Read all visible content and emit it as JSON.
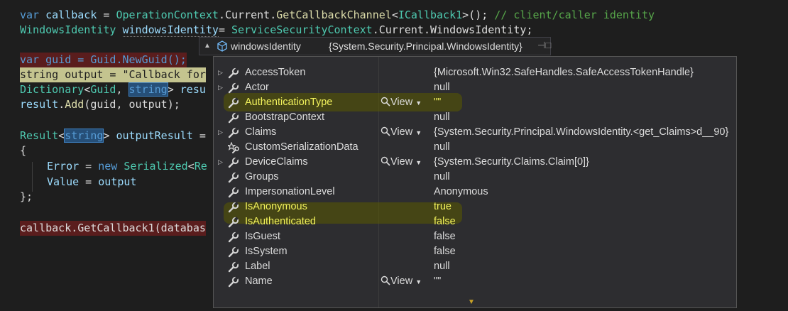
{
  "code": {
    "line1": {
      "kw": "var",
      "id": "callback",
      "eq": " = ",
      "t1": "OperationContext",
      "d1": ".",
      "p1": "Current",
      "d2": ".",
      "fn": "GetCallbackChannel",
      "lt": "<",
      "t2": "ICallback1",
      "rest": ">();",
      "comment": " // client/caller identity"
    },
    "line2": {
      "t1": "WindowsIdentity",
      "id": "windowsIdentity",
      "eq": "= ",
      "t2": "ServiceSecurityContext",
      "d1": ".",
      "p1": "Current",
      "d2": ".",
      "p2": "WindowsIdentity",
      "semi": ";"
    },
    "line4": {
      "text": "var guid = Guid.NewGuid();"
    },
    "line5": {
      "text": "string output = \"Callback for"
    },
    "line6": {
      "t1": "Dictionary",
      "lt": "<",
      "t2": "Guid",
      "comma": ", ",
      "kw": "string",
      "gt": "> ",
      "id": "resu"
    },
    "line7": {
      "id": "result",
      "d": ".",
      "fn": "Add",
      "args": "(guid, output);"
    },
    "line9": {
      "t1": "Result",
      "lt": "<",
      "kw": "string",
      "gt": "> ",
      "id": "outputResult",
      "eq": " ="
    },
    "line10": {
      "text": "{"
    },
    "line11": {
      "p": "Error",
      "eq": " = ",
      "kw": "new",
      "sp": " ",
      "t": "Serialized",
      "lt": "<",
      "t2": "Re"
    },
    "line12": {
      "p": "Value",
      "eq": " = ",
      "id": "output"
    },
    "line13": {
      "text": "};"
    },
    "line15": {
      "text": "callback.GetCallback1(databas"
    }
  },
  "datatip": {
    "name": "windowsIdentity",
    "value": "{System.Security.Principal.WindowsIdentity}",
    "view_label": "View",
    "rows": [
      {
        "name": "AccessToken",
        "expandable": true,
        "view": false,
        "value": "{Microsoft.Win32.SafeHandles.SafeAccessTokenHandle}",
        "icon": "wrench-icon",
        "highlight": false
      },
      {
        "name": "Actor",
        "expandable": true,
        "view": false,
        "value": "null",
        "icon": "wrench-icon",
        "highlight": false
      },
      {
        "name": "AuthenticationType",
        "expandable": false,
        "view": true,
        "value": "\"\"",
        "icon": "wrench-icon",
        "highlight": true
      },
      {
        "name": "BootstrapContext",
        "expandable": false,
        "view": false,
        "value": "null",
        "icon": "wrench-icon",
        "highlight": false
      },
      {
        "name": "Claims",
        "expandable": true,
        "view": true,
        "value": "{System.Security.Principal.WindowsIdentity.<get_Claims>d__90}",
        "icon": "wrench-icon",
        "highlight": false
      },
      {
        "name": "CustomSerializationData",
        "expandable": false,
        "view": false,
        "value": "null",
        "icon": "star-wrench-icon",
        "highlight": false
      },
      {
        "name": "DeviceClaims",
        "expandable": true,
        "view": true,
        "value": "{System.Security.Claims.Claim[0]}",
        "icon": "wrench-icon",
        "highlight": false
      },
      {
        "name": "Groups",
        "expandable": false,
        "view": false,
        "value": "null",
        "icon": "wrench-icon",
        "highlight": false
      },
      {
        "name": "ImpersonationLevel",
        "expandable": false,
        "view": false,
        "value": "Anonymous",
        "icon": "wrench-icon",
        "highlight": false
      },
      {
        "name": "IsAnonymous",
        "expandable": false,
        "view": false,
        "value": "true",
        "icon": "wrench-icon",
        "highlight": true
      },
      {
        "name": "IsAuthenticated",
        "expandable": false,
        "view": false,
        "value": "false",
        "icon": "wrench-icon",
        "highlight": true
      },
      {
        "name": "IsGuest",
        "expandable": false,
        "view": false,
        "value": "false",
        "icon": "wrench-icon",
        "highlight": false
      },
      {
        "name": "IsSystem",
        "expandable": false,
        "view": false,
        "value": "false",
        "icon": "wrench-icon",
        "highlight": false
      },
      {
        "name": "Label",
        "expandable": false,
        "view": false,
        "value": "null",
        "icon": "wrench-icon",
        "highlight": false
      },
      {
        "name": "Name",
        "expandable": false,
        "view": true,
        "value": "\"\"",
        "icon": "wrench-icon",
        "highlight": false
      }
    ]
  },
  "colors": {
    "keyword": "#569cd6",
    "type": "#4ec9b0",
    "identifier": "#9cdcfe",
    "comment": "#57a64a",
    "method": "#dcdcaa",
    "highlight": "#f2f25c"
  }
}
